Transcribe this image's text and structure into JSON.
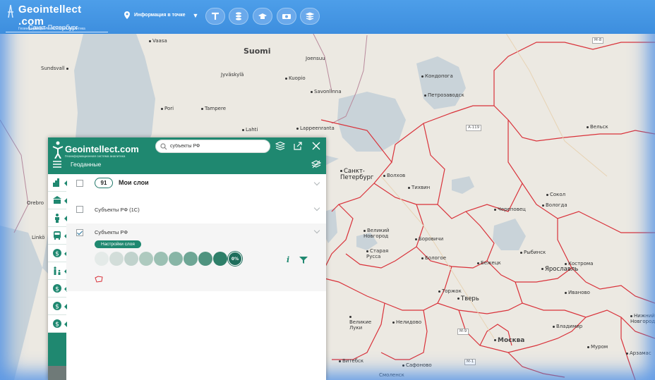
{
  "topbar": {
    "logo_title": "Geointellect .com",
    "logo_subtitle": "Геоинформационная система аналитика",
    "city": "Санкт-Петербург",
    "info_label": "Информация в точке",
    "tools": [
      "text-tool-icon",
      "coins-stack-icon",
      "education-cap-icon",
      "money-icon",
      "layers-icon"
    ]
  },
  "map": {
    "country_label": "Suomi",
    "places": [
      {
        "name": "Vaasa"
      },
      {
        "name": "Sundsvall"
      },
      {
        "name": "Joensuu"
      },
      {
        "name": "Jyväskylä"
      },
      {
        "name": "Kuopio"
      },
      {
        "name": "Savonlinna"
      },
      {
        "name": "Pori"
      },
      {
        "name": "Tampere"
      },
      {
        "name": "Lahti"
      },
      {
        "name": "Lappeenranta"
      },
      {
        "name": "Orebro"
      },
      {
        "name": "Linkö"
      },
      {
        "name": "Кондопога"
      },
      {
        "name": "Петрозаводск"
      },
      {
        "name": "Вельск"
      },
      {
        "name": "Санкт-Петербург"
      },
      {
        "name": "Волхов"
      },
      {
        "name": "Тихвин"
      },
      {
        "name": "Сокол"
      },
      {
        "name": "Вологда"
      },
      {
        "name": "Череповец"
      },
      {
        "name": "Великий Новгород"
      },
      {
        "name": "Боровичи"
      },
      {
        "name": "Старая Русса"
      },
      {
        "name": "Бологое"
      },
      {
        "name": "Бежецк"
      },
      {
        "name": "Рыбинск"
      },
      {
        "name": "Кострома"
      },
      {
        "name": "Ярославль"
      },
      {
        "name": "Торжок"
      },
      {
        "name": "Тверь"
      },
      {
        "name": "Иваново"
      },
      {
        "name": "Великие Луки"
      },
      {
        "name": "Нелидово"
      },
      {
        "name": "Владимир"
      },
      {
        "name": "Нижний Новгород"
      },
      {
        "name": "Москва"
      },
      {
        "name": "Муром"
      },
      {
        "name": "Арзамас"
      },
      {
        "name": "Витебск"
      },
      {
        "name": "Сафоново"
      },
      {
        "name": "Смоленск"
      }
    ],
    "roads": [
      "M-8",
      "A-119",
      "M-9",
      "M-1"
    ],
    "border_color": "#d9323a",
    "water_color": "#c9d3d9"
  },
  "panel": {
    "logo_title": "Geointellect.com",
    "logo_subtitle": "Геоинформационная система аналитика",
    "search_value": "субъекты РФ",
    "section_title": "Геоданные",
    "accent_color": "#1f8870",
    "rail_icons": [
      "city-icon",
      "bank-icon",
      "person-icon",
      "bus-icon",
      "dollar-icon",
      "family-icon",
      "dollar-icon",
      "dollar-icon",
      "dollar-icon"
    ],
    "my_layers": {
      "count": "91",
      "label": "Мои слои"
    },
    "layers": [
      {
        "label": "Субъекты РФ (1С)",
        "checked": false
      },
      {
        "label": "Субъекты РФ",
        "checked": true
      }
    ],
    "settings_label": "Настройки слоя",
    "opacity_steps": [
      "",
      "",
      "",
      "",
      "",
      "",
      "",
      "",
      "",
      "0%"
    ],
    "opacity_selected": "0%"
  }
}
